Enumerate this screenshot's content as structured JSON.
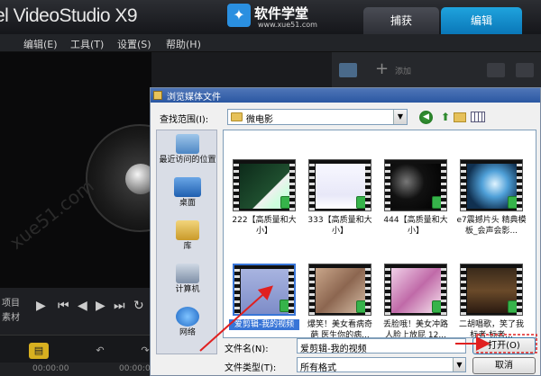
{
  "app": {
    "title": "el VideoStudio X9",
    "tabs": [
      "捕获",
      "编辑"
    ],
    "menu": [
      "编辑(E)",
      "工具(T)",
      "设置(S)",
      "帮助(H)"
    ],
    "watermark": {
      "name": "软件学堂",
      "url": "www.xue51.com"
    },
    "preview_watermark": "xue51.com",
    "controls": {
      "project_label": "项目",
      "clip_label": "素材"
    },
    "library": {
      "add_label": "添加"
    },
    "timeline": {
      "time_a": "00:00:00",
      "time_b": "00:00:02"
    }
  },
  "dialog": {
    "title": "浏览媒体文件",
    "look_in_label": "查找范围(I):",
    "look_in_value": "微电影",
    "places": [
      "最近访问的位置",
      "桌面",
      "库",
      "计算机",
      "网络"
    ],
    "files": [
      "222【高质量和大小】",
      "333【高质量和大小】",
      "444【高质量和大小】",
      "e7震撼片头 精典模板_会声会影...",
      "爱剪辑-我的视频",
      "爆笑！美女看病奇葩 医生你的病...",
      "丢脸哦！美女冲路人脸上放屁 12...",
      "二胡唱歌，笑了我 标者 标者..."
    ],
    "file_name_label": "文件名(N):",
    "file_name_value": "爱剪辑-我的视频",
    "file_type_label": "文件类型(T):",
    "file_type_value": "所有格式",
    "open_button": "打开(O)",
    "cancel_button": "取消"
  },
  "colors": {
    "accent_tab": "#0a77b8",
    "annotation_arrow": "#e02020",
    "selection": "#3875d7"
  }
}
